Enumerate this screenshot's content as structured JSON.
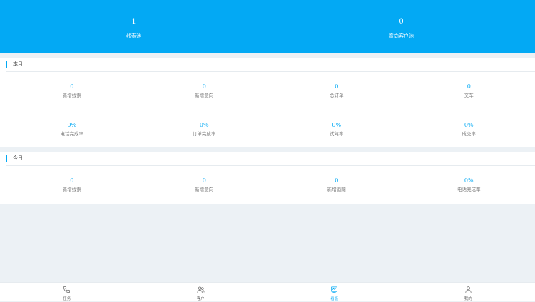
{
  "header": {
    "stats": [
      {
        "value": "1",
        "label": "线索池"
      },
      {
        "value": "0",
        "label": "意向客户池"
      }
    ]
  },
  "month": {
    "title": "本月",
    "row1": [
      {
        "value": "0",
        "label": "新增线索"
      },
      {
        "value": "0",
        "label": "新增意向"
      },
      {
        "value": "0",
        "label": "总订单"
      },
      {
        "value": "0",
        "label": "交车"
      }
    ],
    "row2": [
      {
        "value": "0%",
        "label": "电话完成率"
      },
      {
        "value": "0%",
        "label": "订单完成率"
      },
      {
        "value": "0%",
        "label": "试驾率"
      },
      {
        "value": "0%",
        "label": "成交率"
      }
    ]
  },
  "today": {
    "title": "今日",
    "row1": [
      {
        "value": "0",
        "label": "新增线索"
      },
      {
        "value": "0",
        "label": "新增意向"
      },
      {
        "value": "0",
        "label": "新增追踪"
      },
      {
        "value": "0%",
        "label": "电话完成率"
      }
    ]
  },
  "tabbar": {
    "items": [
      {
        "label": "任务",
        "icon": "phone-icon"
      },
      {
        "label": "客户",
        "icon": "users-icon"
      },
      {
        "label": "看板",
        "icon": "chart-icon"
      },
      {
        "label": "我的",
        "icon": "person-icon"
      }
    ],
    "active_index": 2
  },
  "colors": {
    "accent": "#03a9f4",
    "background": "#ecf1f5"
  }
}
